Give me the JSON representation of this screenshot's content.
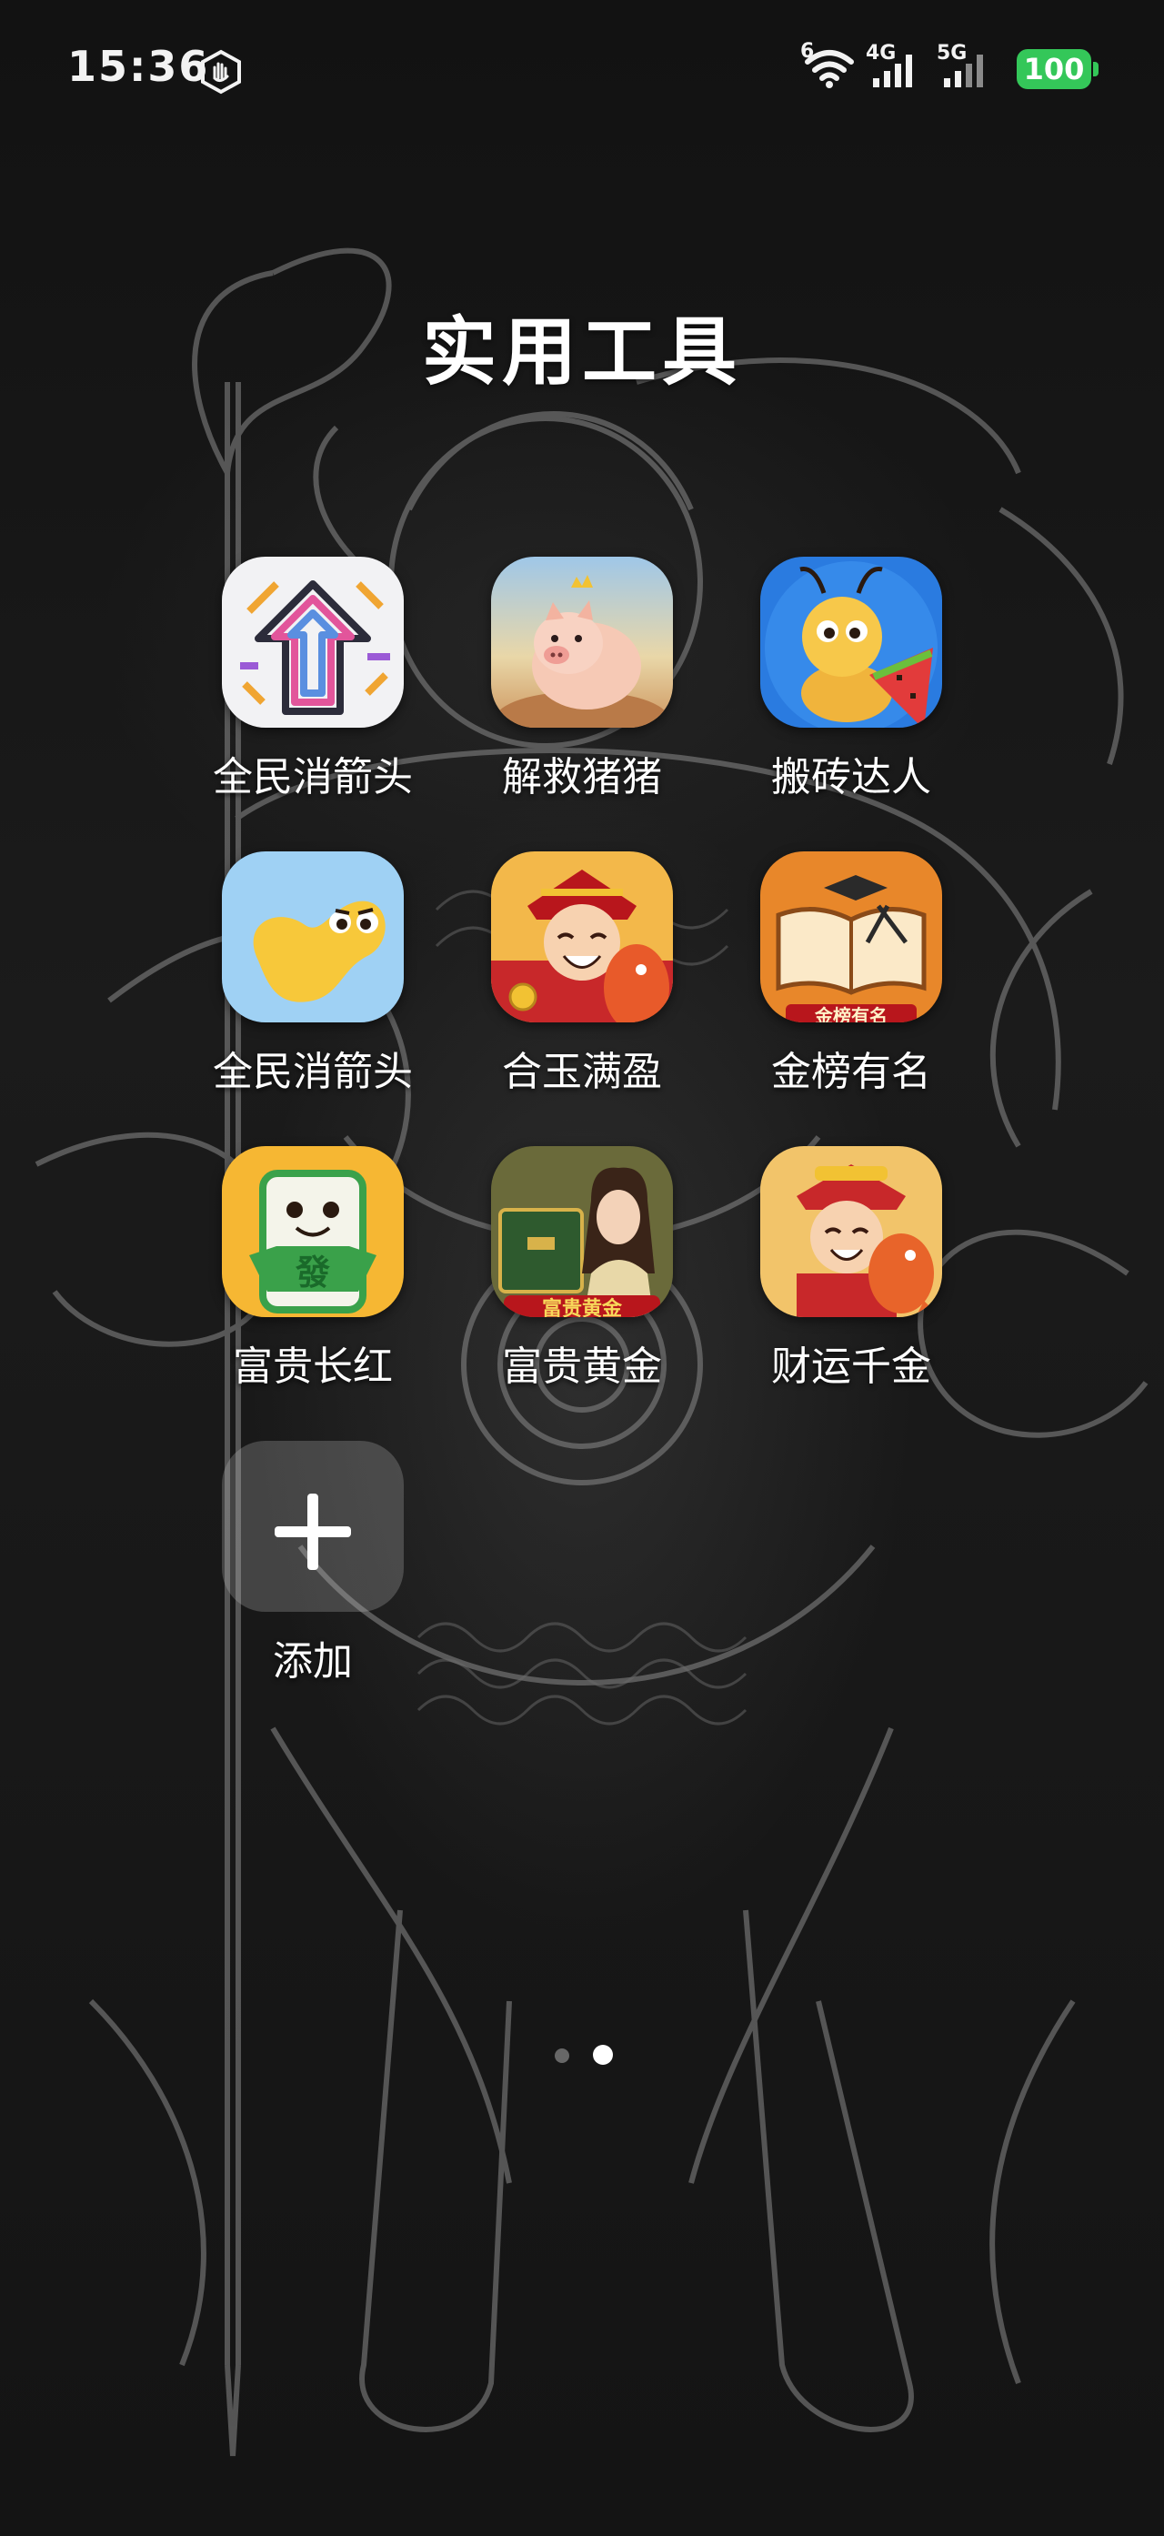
{
  "status_bar": {
    "time": "15:36",
    "wifi_superscript": "6",
    "network_1": "4G",
    "network_2": "5G",
    "battery": "100",
    "icons": [
      "gesture-icon",
      "wifi-icon",
      "signal-icon",
      "battery-icon"
    ]
  },
  "folder": {
    "title": "实用工具",
    "apps": [
      {
        "label": "全民消箭头",
        "icon": "arrow-puzzle-icon"
      },
      {
        "label": "解救猪猪",
        "icon": "pig-icon"
      },
      {
        "label": "搬砖达人",
        "icon": "ant-icon"
      },
      {
        "label": "全民消箭头",
        "icon": "bean-character-icon"
      },
      {
        "label": "合玉满盈",
        "icon": "god-of-wealth-icon"
      },
      {
        "label": "金榜有名",
        "icon": "graduation-book-icon",
        "icon_text": "金榜有名"
      },
      {
        "label": "富贵长红",
        "icon": "mahjong-tile-icon",
        "icon_text": "發"
      },
      {
        "label": "富贵黄金",
        "icon": "lady-gold-icon",
        "icon_text": "富贵黄金"
      },
      {
        "label": "财运千金",
        "icon": "fortune-fish-icon"
      }
    ],
    "add_label": "添加"
  },
  "page_indicator": {
    "pages": 2,
    "current": 2
  },
  "colors": {
    "battery": "#34c759",
    "background": "#141414"
  }
}
